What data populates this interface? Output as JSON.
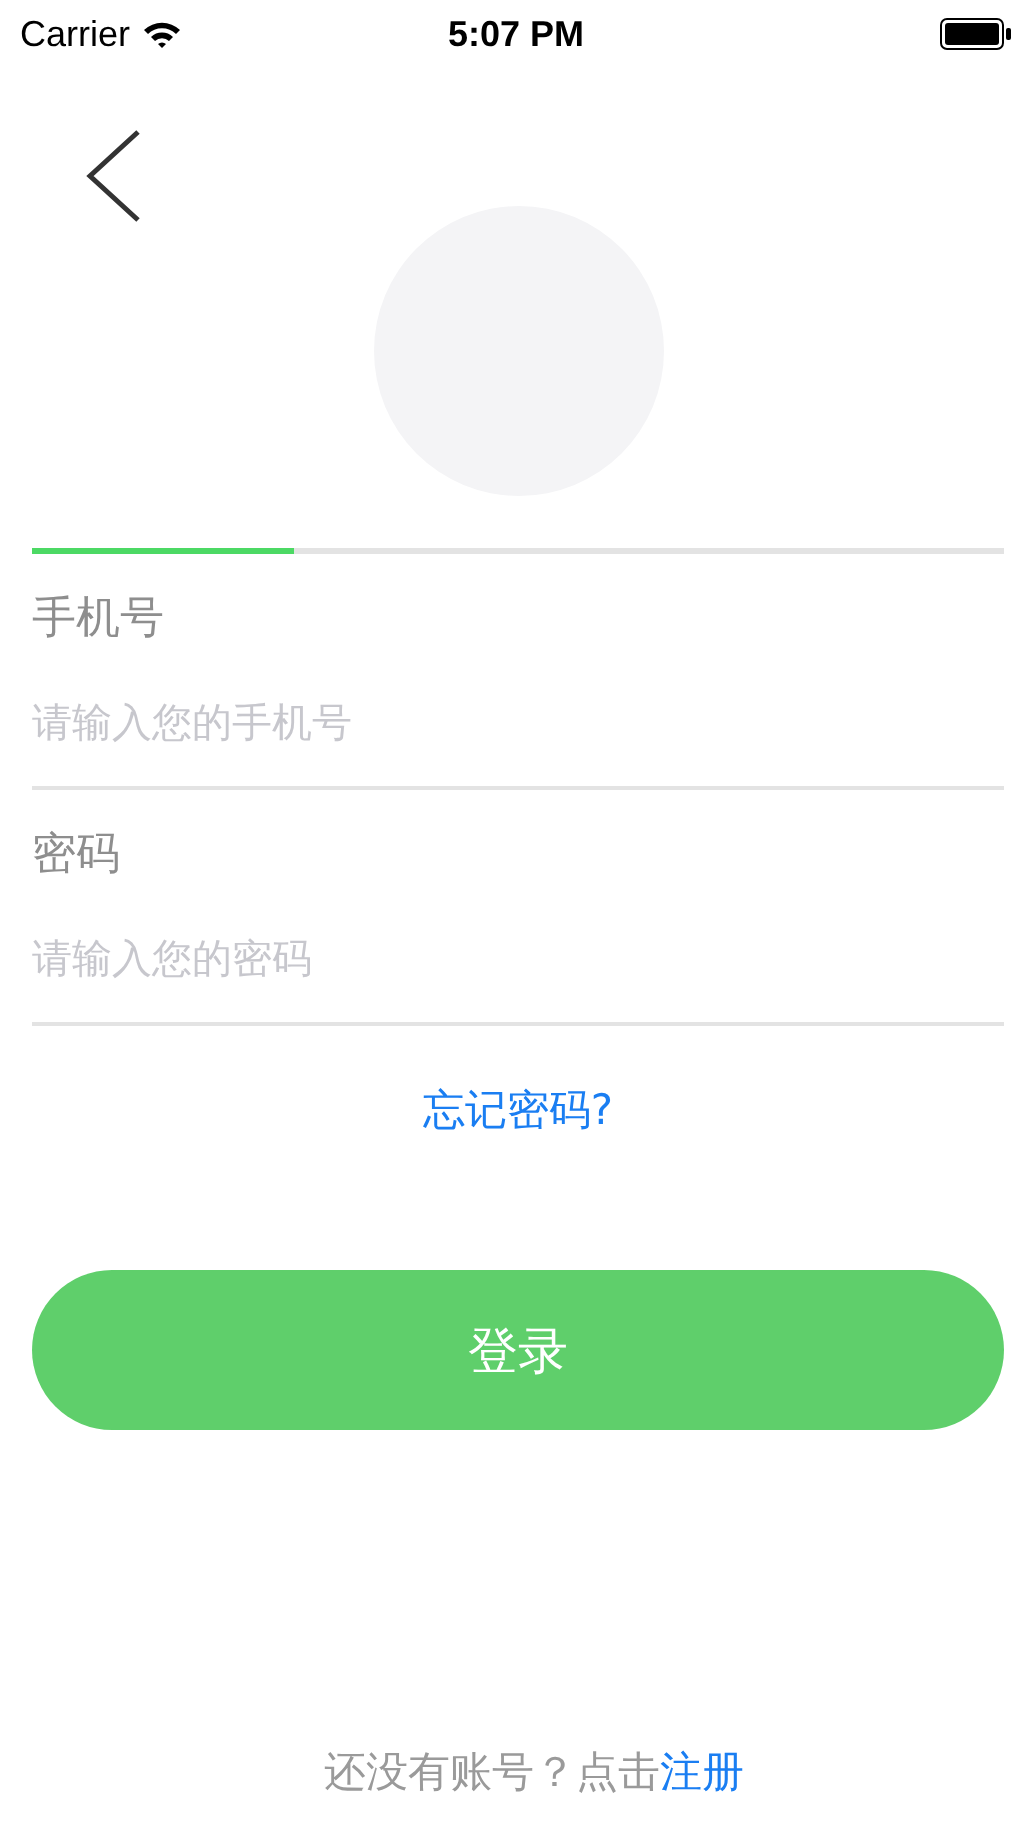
{
  "status_bar": {
    "carrier": "Carrier",
    "time": "5:07 PM"
  },
  "progress": {
    "level": 0.27
  },
  "fields": [
    {
      "label": "手机号",
      "placeholder": "请输入您的手机号"
    },
    {
      "label": "密码",
      "placeholder": "请输入您的密码"
    }
  ],
  "forgot_link": "忘记密码?",
  "login_button": "登录",
  "footer": {
    "text": "还没有账号？点击",
    "link": "注册"
  }
}
